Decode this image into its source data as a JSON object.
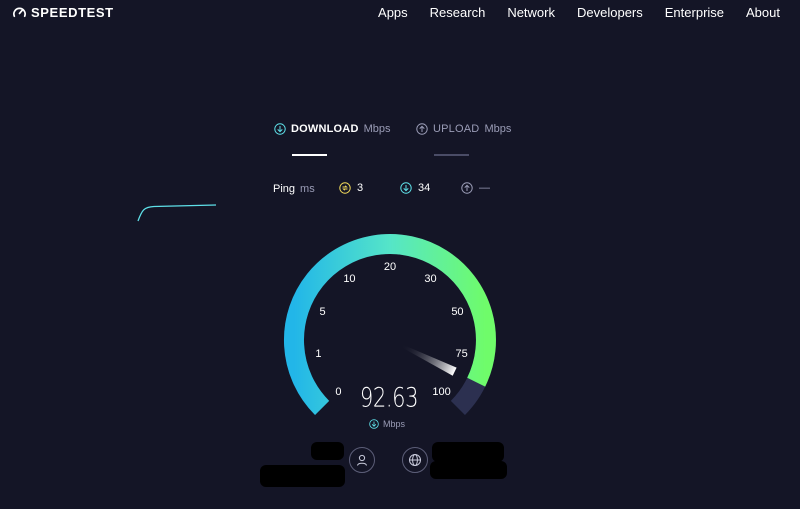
{
  "header": {
    "logo_text": "SPEEDTEST",
    "logo_icon": "speedometer-icon",
    "nav": [
      "Apps",
      "Research",
      "Network",
      "Developers",
      "Enterprise",
      "About"
    ]
  },
  "tabs": {
    "download": {
      "name": "DOWNLOAD",
      "unit": "Mbps",
      "icon": "arrow-down-circle-icon",
      "active": true
    },
    "upload": {
      "name": "UPLOAD",
      "unit": "Mbps",
      "icon": "arrow-up-circle-icon",
      "active": false
    }
  },
  "ping": {
    "label": "Ping",
    "unit": "ms",
    "jitter_value": "3",
    "download_ping": "34",
    "upload_ping": "—"
  },
  "gauge": {
    "scale_labels": [
      "0",
      "1",
      "5",
      "10",
      "20",
      "30",
      "50",
      "75",
      "100"
    ],
    "current_speed": "92.63",
    "unit": "Mbps",
    "needle_fraction": 0.93
  },
  "colors": {
    "background": "#141526",
    "gauge_start": "#22b6e8",
    "gauge_end": "#6ffc6a",
    "accent_cyan": "#5ee0e8",
    "jitter_yellow": "#f0d85a",
    "muted": "#9a9cb6"
  }
}
